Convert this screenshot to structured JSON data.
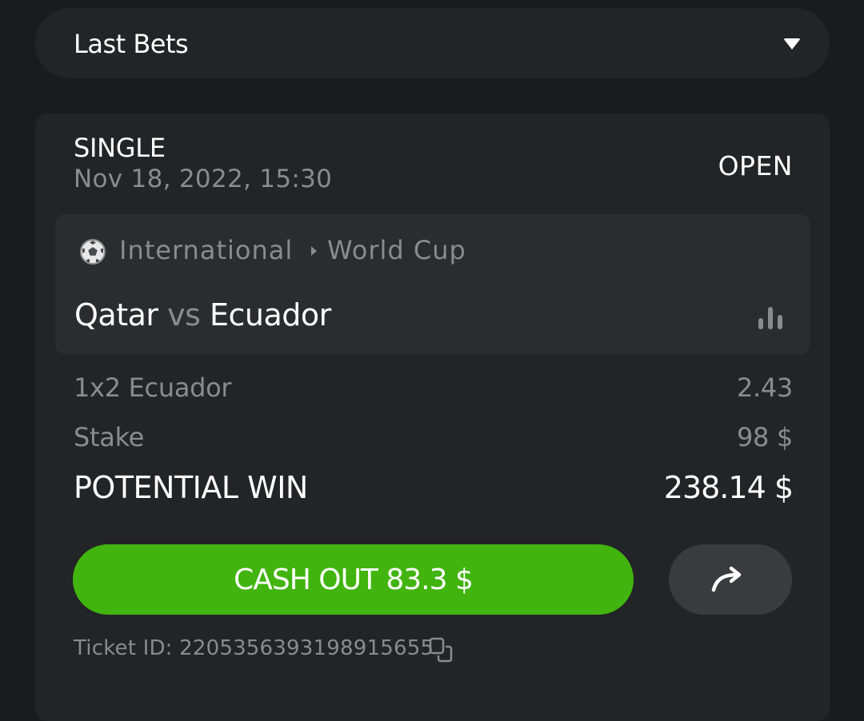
{
  "dropdown": {
    "title": "Last Bets",
    "caret_icon": "caret-down-icon"
  },
  "bet": {
    "type": "SINGLE",
    "date": "Nov 18, 2022, 15:30",
    "status": "OPEN",
    "event": {
      "sport_icon": "soccer-ball-icon",
      "country": "International",
      "league": "World Cup",
      "home": "Qatar",
      "vs": "vs",
      "away": "Ecuador",
      "stats_icon": "bar-chart-icon"
    },
    "selection_label": "1x2 Ecuador",
    "odds": "2.43",
    "stake_label": "Stake",
    "stake_value": "98 $",
    "potential_win_label": "POTENTIAL WIN",
    "potential_win_value": "238.14 $",
    "cashout_label": "CASH OUT 83.3 $",
    "share_icon": "share-arrow-icon",
    "ticket_id": "Ticket ID: 2205356393198915655",
    "copy_icon": "copy-icon"
  },
  "colors": {
    "background": "#1a1b1e",
    "card": "#232427",
    "event_box": "#2b2c30",
    "muted_text": "#8a8b8f",
    "accent_green": "#41b40f",
    "share_button": "#3a3b3f"
  }
}
